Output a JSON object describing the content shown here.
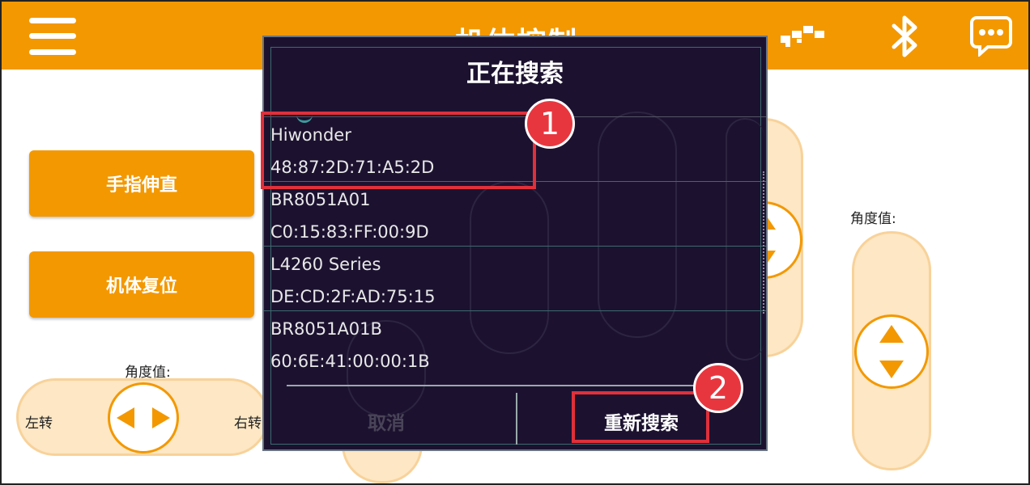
{
  "app": {
    "title": "机体控制",
    "menu_icon": "hamburger-menu-icon",
    "action_icon": "action-group-icon",
    "bluetooth_icon": "bluetooth-icon",
    "chat_icon": "chat-bubble-icon"
  },
  "controls": {
    "finger_straight_label": "手指伸直",
    "body_reset_label": "机体复位",
    "angle_label": "角度值:",
    "turn_left_label": "左转",
    "turn_right_label": "右转"
  },
  "dialog": {
    "title": "正在搜索",
    "devices": [
      {
        "name": "Hiwonder",
        "mac": "48:87:2D:71:A5:2D"
      },
      {
        "name": "BR8051A01",
        "mac": "C0:15:83:FF:00:9D"
      },
      {
        "name": "L4260 Series",
        "mac": "DE:CD:2F:AD:75:15"
      },
      {
        "name": "BR8051A01B",
        "mac": "60:6E:41:00:00:1B"
      }
    ],
    "cancel_label": "取消",
    "rescan_label": "重新搜索"
  },
  "callouts": [
    "1",
    "2"
  ],
  "colors": {
    "accent": "#f39800",
    "dialog_bg": "#1c1230",
    "highlight": "#e0303a",
    "pad_fill": "#fde7c4"
  }
}
